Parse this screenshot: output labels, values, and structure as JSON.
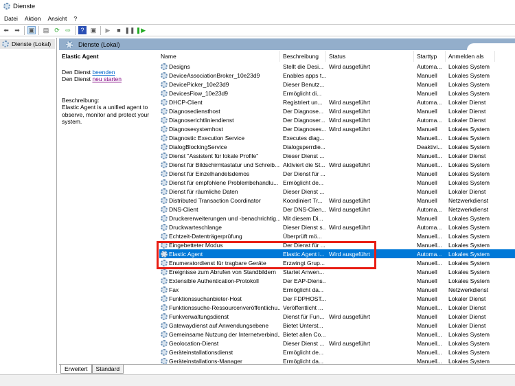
{
  "window": {
    "title": "Dienste"
  },
  "menu": [
    "Datei",
    "Aktion",
    "Ansicht",
    "?"
  ],
  "tree": {
    "root": "Dienste (Lokal)"
  },
  "panel": {
    "title": "Dienste (Lokal)"
  },
  "details": {
    "name": "Elastic Agent",
    "line1_prefix": "Den Dienst",
    "stop_link": "beenden",
    "line2_prefix": "Den Dienst",
    "restart_link": "neu starten",
    "desc_label": "Beschreibung:",
    "desc_text": "Elastic Agent is a unified agent to observe, monitor and protect your system."
  },
  "columns": [
    "Name",
    "Beschreibung",
    "Status",
    "Starttyp",
    "Anmelden als"
  ],
  "rows": [
    [
      "Designs",
      "Stellt die Desi...",
      "Wird ausgeführt",
      "Automa...",
      "Lokales System"
    ],
    [
      "DeviceAssociationBroker_10e23d9",
      "Enables apps t...",
      "",
      "Manuell",
      "Lokales System"
    ],
    [
      "DevicePicker_10e23d9",
      "Dieser Benutz...",
      "",
      "Manuell",
      "Lokales System"
    ],
    [
      "DevicesFlow_10e23d9",
      "Ermöglicht di...",
      "",
      "Manuell",
      "Lokales System"
    ],
    [
      "DHCP-Client",
      "Registriert un...",
      "Wird ausgeführt",
      "Automa...",
      "Lokaler Dienst"
    ],
    [
      "Diagnosediensthost",
      "Der Diagnose...",
      "Wird ausgeführt",
      "Manuell",
      "Lokaler Dienst"
    ],
    [
      "Diagnoserichtliniendienst",
      "Der Diagnoser...",
      "Wird ausgeführt",
      "Automa...",
      "Lokaler Dienst"
    ],
    [
      "Diagnosesystemhost",
      "Der Diagnoses...",
      "Wird ausgeführt",
      "Manuell",
      "Lokales System"
    ],
    [
      "Diagnostic Execution Service",
      "Executes diag...",
      "",
      "Manuell...",
      "Lokales System"
    ],
    [
      "DialogBlockingService",
      "Dialogsperrdie...",
      "",
      "Deaktivi...",
      "Lokales System"
    ],
    [
      "Dienst \"Assistent für lokale Profile\"",
      "Dieser Dienst ...",
      "",
      "Manuell...",
      "Lokaler Dienst"
    ],
    [
      "Dienst für Bildschirmtastatur und Schreib...",
      "Aktiviert die St...",
      "Wird ausgeführt",
      "Manuell...",
      "Lokales System"
    ],
    [
      "Dienst für Einzelhandelsdemos",
      "Der Dienst für ...",
      "",
      "Manuell",
      "Lokales System"
    ],
    [
      "Dienst für empfohlene Problembehandlu...",
      "Ermöglicht de...",
      "",
      "Manuell",
      "Lokales System"
    ],
    [
      "Dienst für räumliche Daten",
      "Dieser Dienst ...",
      "",
      "Manuell",
      "Lokaler Dienst"
    ],
    [
      "Distributed Transaction Coordinator",
      "Koordiniert Tr...",
      "Wird ausgeführt",
      "Manuell",
      "Netzwerkdienst"
    ],
    [
      "DNS-Client",
      "Der DNS-Clien...",
      "Wird ausgeführt",
      "Automa...",
      "Netzwerkdienst"
    ],
    [
      "Druckererweiterungen und -benachrichtig...",
      "Mit diesem Di...",
      "",
      "Manuell",
      "Lokales System"
    ],
    [
      "Druckwarteschlange",
      "Dieser Dienst s...",
      "Wird ausgeführt",
      "Automa...",
      "Lokales System"
    ],
    [
      "Echtzeit-Datenträgerprüfung",
      "Überprüft mö...",
      "",
      "Manuell...",
      "Lokales System"
    ],
    [
      "Eingebetteter Modus",
      "Der Dienst für ...",
      "",
      "Manuell...",
      "Lokales System"
    ],
    [
      "Elastic Agent",
      "Elastic Agent i...",
      "Wird ausgeführt",
      "Automa...",
      "Lokales System"
    ],
    [
      "Enumeratordienst für tragbare Geräte",
      "Erzwingt Grup...",
      "",
      "Manuell...",
      "Lokales System"
    ],
    [
      "Ereignisse zum Abrufen von Standbildern",
      "Startet Anwen...",
      "",
      "Manuell",
      "Lokales System"
    ],
    [
      "Extensible Authentication-Protokoll",
      "Der EAP-Diens...",
      "",
      "Manuell",
      "Lokales System"
    ],
    [
      "Fax",
      "Ermöglicht da...",
      "",
      "Manuell",
      "Netzwerkdienst"
    ],
    [
      "Funktionssuchanbieter-Host",
      "Der FDPHOST...",
      "",
      "Manuell",
      "Lokaler Dienst"
    ],
    [
      "Funktionssuche-Ressourcenveröffentlichu...",
      "Veröffentlicht ...",
      "",
      "Manuell...",
      "Lokaler Dienst"
    ],
    [
      "Funkverwaltungsdienst",
      "Dienst für Fun...",
      "Wird ausgeführt",
      "Manuell",
      "Lokaler Dienst"
    ],
    [
      "Gatewaydienst auf Anwendungsebene",
      "Bietet Unterst...",
      "",
      "Manuell",
      "Lokaler Dienst"
    ],
    [
      "Gemeinsame Nutzung der Internetverbind...",
      "Bietet allen Co...",
      "",
      "Manuell...",
      "Lokales System"
    ],
    [
      "Geolocation-Dienst",
      "Dieser Dienst ...",
      "Wird ausgeführt",
      "Manuell...",
      "Lokales System"
    ],
    [
      "Geräteinstallationsdienst",
      "Ermöglicht de...",
      "",
      "Manuell...",
      "Lokales System"
    ],
    [
      "Geräteinstallations-Manager",
      "Ermöglicht da...",
      "",
      "Manuell...",
      "Lokales System"
    ]
  ],
  "selected_row": 21,
  "tabs": [
    "Erweitert",
    "Standard"
  ],
  "colors": {
    "selection": "#0078d7",
    "highlight": "#e81e14",
    "panel_header": "#93aecb"
  }
}
